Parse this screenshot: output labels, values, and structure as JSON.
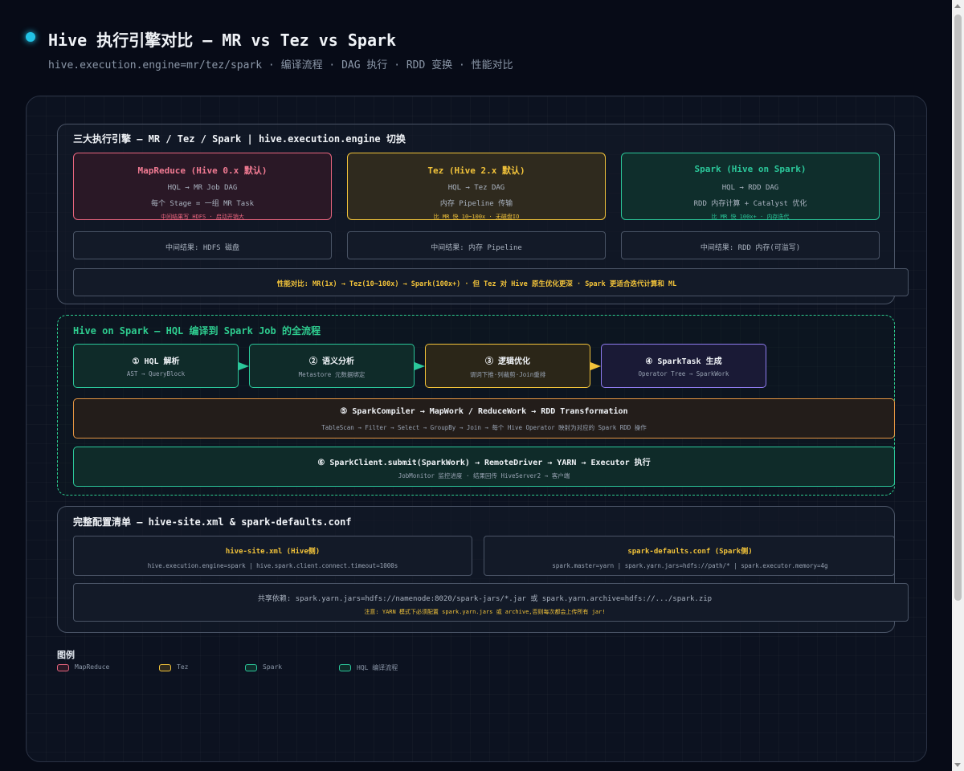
{
  "header": {
    "title": "Hive 执行引擎对比 — MR vs Tez vs Spark",
    "subtitle": "hive.execution.engine=mr/tez/spark · 编译流程 · DAG 执行 · RDD 变换 · 性能对比"
  },
  "engines": {
    "title": "三大执行引擎 — MR / Tez / Spark | hive.execution.engine 切换",
    "mr": {
      "name": "MapReduce (Hive 0.x 默认)",
      "line1": "HQL → MR Job DAG",
      "line2": "每个 Stage = 一组 MR Task",
      "note": "中间结果写 HDFS · 启动开销大",
      "storage": "中间结果: HDFS 磁盘"
    },
    "tez": {
      "name": "Tez (Hive 2.x 默认)",
      "line1": "HQL → Tez DAG",
      "line2": "内存 Pipeline 传输",
      "note": "比 MR 快 10~100x · 无磁盘IO",
      "storage": "中间结果: 内存 Pipeline"
    },
    "spark": {
      "name": "Spark (Hive on Spark)",
      "line1": "HQL → RDD DAG",
      "line2": "RDD 内存计算 + Catalyst 优化",
      "note": "比 MR 快 100x+ · 内存迭代",
      "storage": "中间结果: RDD 内存(可溢写)"
    },
    "perf": "性能对比: MR(1x) → Tez(10~100x) → Spark(100x+) · 但 Tez 对 Hive 原生优化更深 · Spark 更适合迭代计算和 ML"
  },
  "flow": {
    "title": "Hive on Spark — HQL 编译到 Spark Job 的全流程",
    "steps": [
      {
        "title": "① HQL 解析",
        "sub": "AST → QueryBlock"
      },
      {
        "title": "② 语义分析",
        "sub": "Metastore 元数据绑定"
      },
      {
        "title": "③ 逻辑优化",
        "sub": "谓词下推·列裁剪·Join重排"
      },
      {
        "title": "④ SparkTask 生成",
        "sub": "Operator Tree → SparkWork"
      }
    ],
    "step5": {
      "title": "⑤ SparkCompiler → MapWork / ReduceWork → RDD Transformation",
      "sub": "TableScan → Filter → Select → GroupBy → Join → 每个 Hive Operator 映射为对应的 Spark RDD 操作"
    },
    "step6": {
      "title": "⑥ SparkClient.submit(SparkWork) → RemoteDriver → YARN → Executor 执行",
      "sub": "JobMonitor 监控进度 · 结果回传 HiveServer2 → 客户端"
    }
  },
  "config": {
    "title": "完整配置清单 — hive-site.xml & spark-defaults.conf",
    "hive_site": {
      "title": "hive-site.xml (Hive侧)",
      "body": "hive.execution.engine=spark | hive.spark.client.connect.timeout=1000s"
    },
    "spark_defaults": {
      "title": "spark-defaults.conf (Spark侧)",
      "body": "spark.master=yarn | spark.yarn.jars=hdfs://path/* | spark.executor.memory=4g"
    },
    "shared": "共享依赖: spark.yarn.jars=hdfs://namenode:8020/spark-jars/*.jar 或 spark.yarn.archive=hdfs://.../spark.zip",
    "warning": "注意: YARN 模式下必须配置 spark.yarn.jars 或 archive,否则每次都会上传所有 jar!"
  },
  "legend": {
    "title": "图例",
    "items": [
      {
        "label": "MapReduce",
        "color": "#e8657e"
      },
      {
        "label": "Tez",
        "color": "#f2c33a"
      },
      {
        "label": "Spark",
        "color": "#2bc79a"
      },
      {
        "label": "HQL 编译流程",
        "color": "#2bc79a"
      }
    ]
  }
}
